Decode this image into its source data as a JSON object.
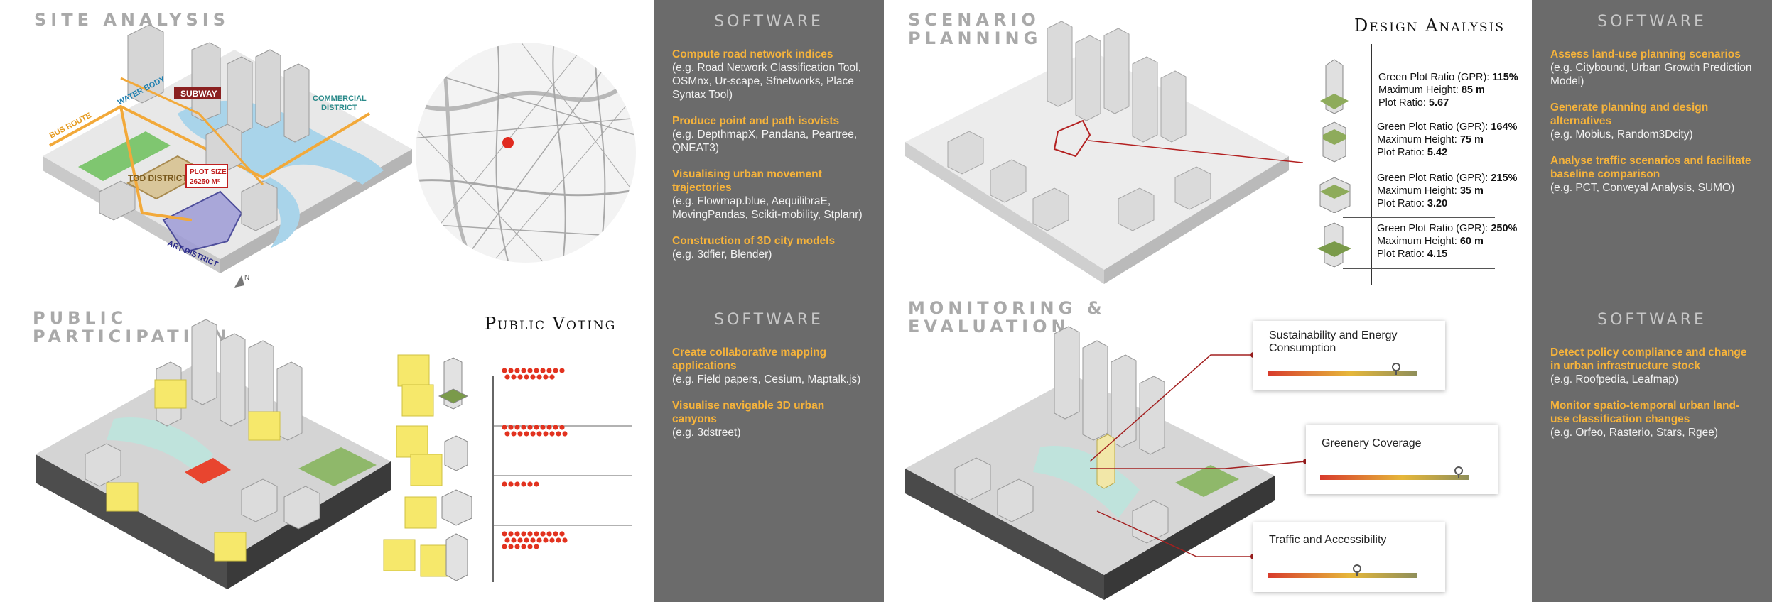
{
  "site_analysis": {
    "title": "SITE ANALYSIS",
    "labels": {
      "bus_route": "BUS ROUTE",
      "water_body": "WATER BODY",
      "subway": "SUBWAY",
      "commercial": "COMMERCIAL",
      "district": "DISTRICT",
      "tod_district": "TOD DISTRICT",
      "plot_size": "PLOT SIZE",
      "plot_value": "26250 M²",
      "art_district": "ART DISTRICT",
      "north": "N"
    }
  },
  "software_1": {
    "title": "SOFTWARE",
    "items": [
      {
        "head": "Compute road network indices",
        "desc": "(e.g. Road Network Classification Tool, OSMnx, Ur-scape, Sfnetworks, Place Syntax Tool)"
      },
      {
        "head": "Produce point and path isovists",
        "desc": "(e.g. DepthmapX, Pandana, Peartree, QNEAT3)"
      },
      {
        "head": "Visualising urban movement trajectories",
        "desc": "(e.g. Flowmap.blue, AequilibraE, MovingPandas, Scikit-mobility, Stplanr)"
      },
      {
        "head": "Construction of 3D city models",
        "desc": "(e.g. 3dfier, Blender)"
      }
    ]
  },
  "scenario_planning": {
    "title_line1": "SCENARIO",
    "title_line2": "PLANNING",
    "design_title": "Design Analysis",
    "gpr_label": "Green Plot Ratio (GPR): ",
    "height_label": "Maximum Height: ",
    "plot_ratio_label": "Plot Ratio: ",
    "options": [
      {
        "gpr": "115%",
        "height": "85 m",
        "plot_ratio": "5.67"
      },
      {
        "gpr": "164%",
        "height": "75 m",
        "plot_ratio": "5.42"
      },
      {
        "gpr": "215%",
        "height": "35 m",
        "plot_ratio": "3.20"
      },
      {
        "gpr": "250%",
        "height": "60 m",
        "plot_ratio": "4.15"
      }
    ]
  },
  "software_2": {
    "title": "SOFTWARE",
    "items": [
      {
        "head": "Assess land-use planning scenarios",
        "desc": "(e.g. Citybound, Urban Growth Prediction Model)"
      },
      {
        "head": "Generate planning and design alternatives",
        "desc": "(e.g. Mobius, Random3Dcity)"
      },
      {
        "head": "Analyse traffic scenarios and facilitate baseline comparison",
        "desc": "(e.g. PCT, Conveyal Analysis, SUMO)"
      }
    ]
  },
  "public_participation": {
    "title_line1": "PUBLIC",
    "title_line2": "PARTICIPATION",
    "voting_title": "Public Voting",
    "vote_counts": [
      18,
      20,
      6,
      26
    ]
  },
  "software_3": {
    "title": "SOFTWARE",
    "items": [
      {
        "head": "Create collaborative mapping applications",
        "desc": "(e.g. Field papers, Cesium, Maptalk.js)"
      },
      {
        "head": "Visualise navigable 3D urban canyons",
        "desc": "(e.g. 3dstreet)"
      }
    ]
  },
  "monitoring": {
    "title_line1": "MONITORING &",
    "title_line2": "EVALUATION",
    "metrics": [
      {
        "label_line1": "Sustainability and Energy",
        "label_line2": "Consumption",
        "level": 0.86
      },
      {
        "label_line1": "Greenery Coverage",
        "label_line2": "",
        "level": 0.93
      },
      {
        "label_line1": "Traffic and Accessibility",
        "label_line2": "",
        "level": 0.6
      }
    ]
  },
  "software_4": {
    "title": "SOFTWARE",
    "items": [
      {
        "head": "Detect policy compliance and change in urban infrastructure stock",
        "desc": "(e.g. Roofpedia, Leafmap)"
      },
      {
        "head": "Monitor spatio-temporal urban land-use classification changes",
        "desc": "(e.g. Orfeo, Rasterio, Stars, Rgee)"
      }
    ]
  }
}
